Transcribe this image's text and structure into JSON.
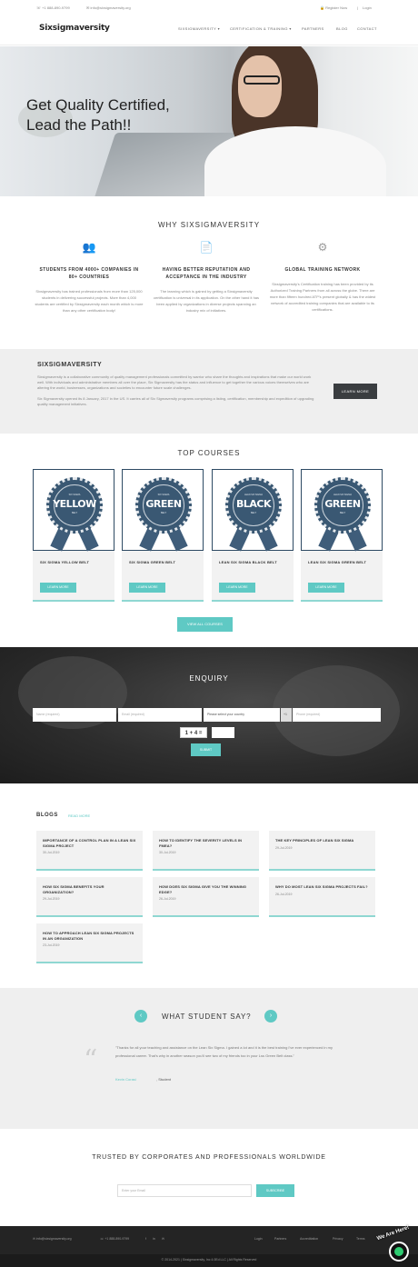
{
  "topbar": {
    "phone": "+1 888-890-9799",
    "email": "info@sixsigmaversity.org",
    "register": "Register Now",
    "separator": "|",
    "login": "Login"
  },
  "nav": {
    "logo": "Sixsigmaversity",
    "items": [
      "SIXSIGMAVERSITY ▾",
      "CERTIFICATION & TRAINING ▾",
      "PARTNERS",
      "BLOG",
      "CONTACT"
    ]
  },
  "hero": {
    "title_line1": "Get Quality Certified,",
    "title_line2": "Lead the Path!!"
  },
  "why": {
    "title": "WHY SIXSIGMAVERSITY",
    "features": [
      {
        "icon": "people-icon",
        "heading": "STUDENTS FROM 4000+ COMPANIES IN 80+ COUNTRIES",
        "text": "Sixsigmaversity has trained professionals from more than 125,000 students in delivering successful projects. More than 4,000 students are certified by Sixsigmaversity each month which is more than any other certification body!"
      },
      {
        "icon": "certificate-icon",
        "heading": "HAVING BETTER REPUTATION AND ACCEPTANCE IN THE INDUSTRY",
        "text": "The learning which is gained by getting a Sixsigmaversity certification is universal in its application. On the other hand it has been applied by organizations in diverse projects spanning an industry mix of initiatives."
      },
      {
        "icon": "globe-network-icon",
        "heading": "GLOBAL TRAINING NETWORK",
        "text": "Sixsigmaversity's Certification training has been provided by its Authorized Training Partners from all across the globe. There are more than fifteen hundred ATP's present globally & has the widest network of accredited training companies that are available to its certifications."
      }
    ]
  },
  "about": {
    "title": "SIXSIGMAVERSITY",
    "text1": "Sixsigmaversity is a collaborative community of quality management professionals committed by warrior who share the thoughts and inspirations that make our world work well. With individuals and administrative members all over the place, Six Sigmaversity has the status and influence to get together the various voices themselves who are altering the world, businesses, organizations and societies to encounter future scale challenges.",
    "text2": "Six Sigmaversity opened its 8 January, 2017 in the US. It carries all of Six Sigmaversity programs comprising a listing, certification, membership and expedition of upgrading quality management initiatives.",
    "button": "LEARN MORE"
  },
  "courses": {
    "title": "TOP COURSES",
    "items": [
      {
        "belt": "YELLOW",
        "top": "SIX SIGMA",
        "sub": "BELT",
        "name": "SIX SIGMA YELLOW BELT",
        "button": "LEARN MORE"
      },
      {
        "belt": "GREEN",
        "top": "SIX SIGMA",
        "sub": "BELT",
        "name": "SIX SIGMA GREEN BELT",
        "button": "LEARN MORE"
      },
      {
        "belt": "BLACK",
        "top": "LEAN SIX SIGMA",
        "sub": "BELT",
        "name": "LEAN SIX SIGMA BLACK BELT",
        "button": "LEARN MORE"
      },
      {
        "belt": "GREEN",
        "top": "LEAN SIX SIGMA",
        "sub": "BELT",
        "name": "LEAN SIX SIGMA GREEN BELT",
        "button": "LEARN MORE"
      }
    ],
    "view_all": "VIEW ALL COURSES"
  },
  "enquiry": {
    "title": "ENQUIRY",
    "name_placeholder": "Name (required)",
    "email_placeholder": "Email (required)",
    "country_select": "Please select your country",
    "code": "+1",
    "phone_placeholder": "Phone (required)",
    "captcha": "1 + 4 =",
    "submit": "SUBMIT"
  },
  "blogs": {
    "title": "BLOGS",
    "more": "READ MORE",
    "items": [
      {
        "title": "IMPORTANCE OF A CONTROL PLAN IN A LEAN SIX SIGMA PROJECT",
        "date": "30-Jul-2019"
      },
      {
        "title": "HOW TO IDENTIFY THE SEVERITY LEVELS IN FMEA?",
        "date": "30-Jul-2019"
      },
      {
        "title": "THE KEY PRINCIPLES OF LEAN SIX SIGMA",
        "date": "29-Jul-2019"
      },
      {
        "title": "HOW SIX SIGMA BENEFITS YOUR ORGANIZATION?",
        "date": "29-Jul-2019"
      },
      {
        "title": "HOW DOES SIX SIGMA GIVE YOU THE WINNING EDGE?",
        "date": "26-Jul-2019"
      },
      {
        "title": "WHY DO MOST LEAN SIX SIGMA PROJECTS FAIL?",
        "date": "26-Jul-2019"
      },
      {
        "title": "HOW TO APPROACH LEAN SIX SIGMA PROJECTS IN AN ORGANIZATION",
        "date": "23-Jul-2019"
      }
    ]
  },
  "testimonials": {
    "title": "WHAT STUDENT SAY?",
    "prev": "‹",
    "next": "›",
    "quote_mark": "“",
    "text": "\"Thanks for all your teaching and assistance on the Lean Six Sigma. I gained a lot and it is the best training I've ever experienced in my professional career. That's why in another season you'll see two of my friends too in your Lss Green Belt class.\"",
    "name": "Kevin Corasi",
    "role": ", Student"
  },
  "trusted": {
    "title": "TRUSTED BY CORPORATES AND PROFESSIONALS WORLDWIDE",
    "email_placeholder": "Enter your Email",
    "button": "SUBSCRIBE"
  },
  "footer": {
    "email": "info@sixsigmaversity.org",
    "phone": "+1 888-890-9799",
    "social": [
      "f",
      "in",
      "✉"
    ],
    "links": [
      "Login",
      "Partners",
      "Accreditation",
      "Privacy",
      "Terms"
    ],
    "copyright": "© 2014-2021 | Sixsigmaversity, Inc 4.0Ed LLC | All Rights Reserved",
    "chat_label": "We Are Here!"
  },
  "colors": {
    "accent": "#5fc9c4",
    "dark_button": "#3a3d40",
    "footer_bg": "#242424",
    "belt_navy": "#3a5873"
  }
}
